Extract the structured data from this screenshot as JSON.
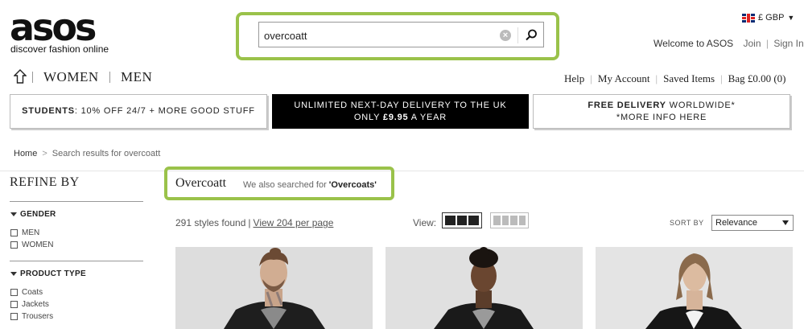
{
  "brand": {
    "logo_text": "asos",
    "tagline": "discover fashion online"
  },
  "search": {
    "value": "overcoatt",
    "clear_icon": "clear-icon",
    "submit_icon": "search-icon",
    "highlight_color": "#9ac24a"
  },
  "header": {
    "currency": "£ GBP",
    "welcome": "Welcome to ASOS",
    "join": "Join",
    "sign_in": "Sign In"
  },
  "nav": {
    "home_icon": "home-icon",
    "women": "WOMEN",
    "men": "MEN",
    "help": "Help",
    "my_account": "My Account",
    "saved_items": "Saved Items",
    "bag": "Bag £0.00 (0)"
  },
  "promos": {
    "students_bold": "STUDENTS",
    "students_rest": ": 10% OFF 24/7 + MORE GOOD STUFF",
    "delivery_line1": "UNLIMITED NEXT-DAY DELIVERY TO THE UK",
    "delivery_line2_pre": "ONLY ",
    "delivery_line2_bold": "£9.95",
    "delivery_line2_post": " A YEAR",
    "free_bold": "FREE DELIVERY",
    "free_rest": " WORLDWIDE*",
    "free_line2": "*MORE INFO HERE"
  },
  "breadcrumb": {
    "home": "Home",
    "separator": ">",
    "current": "Search results for overcoatt"
  },
  "refine": {
    "title": "REFINE BY",
    "gender": {
      "heading": "GENDER",
      "options": [
        "MEN",
        "WOMEN"
      ]
    },
    "product_type": {
      "heading": "PRODUCT TYPE",
      "options": [
        "Coats",
        "Jackets",
        "Trousers"
      ]
    }
  },
  "results": {
    "title": "Overcoatt",
    "also_prefix": "We also searched for ",
    "also_term": "'Overcoats'",
    "count": "291 styles found",
    "per_page_link": "View 204 per page",
    "view_label": "View:",
    "sort_label": "SORT BY",
    "sort_value": "Relevance"
  },
  "products": [
    {
      "name": "product-image-1"
    },
    {
      "name": "product-image-2"
    },
    {
      "name": "product-image-3"
    }
  ]
}
